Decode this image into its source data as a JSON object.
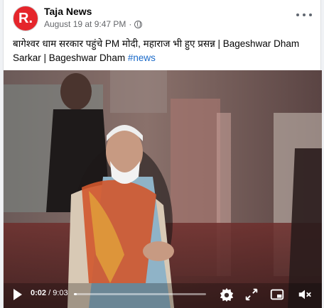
{
  "post": {
    "page_name": "Taja News",
    "avatar_letter": "R.",
    "timestamp": "August 19 at 9:47 PM",
    "separator": "·",
    "caption_text": "बागेश्वर धाम सरकार पहुंचे PM मोदी, महाराज भी हुए प्रसन्न | Bageshwar Dham Sarkar | Bageshwar Dham ",
    "hashtag": "#news"
  },
  "player": {
    "current_time": "0:02",
    "total_time": "/ 9:03",
    "progress_fraction": 0.004
  },
  "icons": [
    "globe-icon",
    "more-options-icon",
    "play-icon",
    "settings-icon",
    "fullscreen-icon",
    "picture-in-picture-icon",
    "volume-muted-icon"
  ],
  "colors": {
    "accent_red": "#e5252b",
    "hashtag_blue": "#1b6ac9"
  }
}
